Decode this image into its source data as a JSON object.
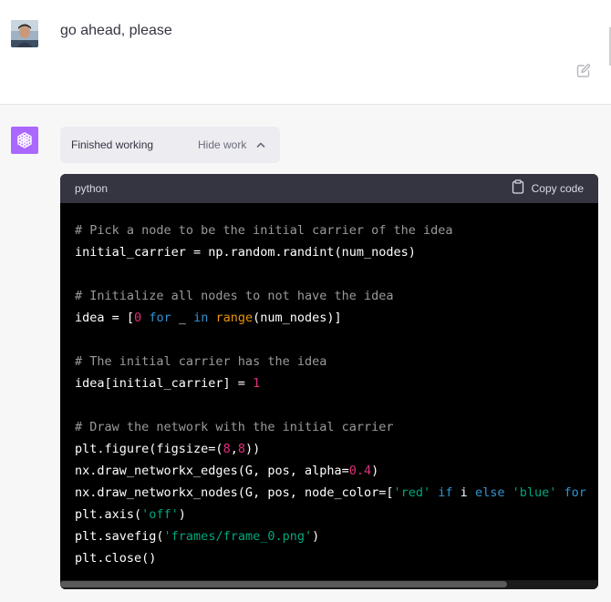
{
  "user": {
    "message": "go ahead, please"
  },
  "assistant": {
    "status": "Finished working",
    "hide_label": "Hide work",
    "code": {
      "language": "python",
      "copy_label": "Copy code",
      "lines": [
        "# Pick a node to be the initial carrier of the idea",
        "initial_carrier = np.random.randint(num_nodes)",
        "",
        "# Initialize all nodes to not have the idea",
        "idea = [0 for _ in range(num_nodes)]",
        "",
        "# The initial carrier has the idea",
        "idea[initial_carrier] = 1",
        "",
        "# Draw the network with the initial carrier",
        "plt.figure(figsize=(8,8))",
        "nx.draw_networkx_edges(G, pos, alpha=0.4)",
        "nx.draw_networkx_nodes(G, pos, node_color=['red' if i else 'blue' for",
        "plt.axis('off')",
        "plt.savefig('frames/frame_0.png')",
        "plt.close()"
      ]
    }
  },
  "colors": {
    "comment": "#9a9a9a",
    "number": "#df3079",
    "keyword": "#2e95d3",
    "builtin": "#e9950c",
    "string": "#00a67d",
    "brand": "#ab68ff"
  }
}
